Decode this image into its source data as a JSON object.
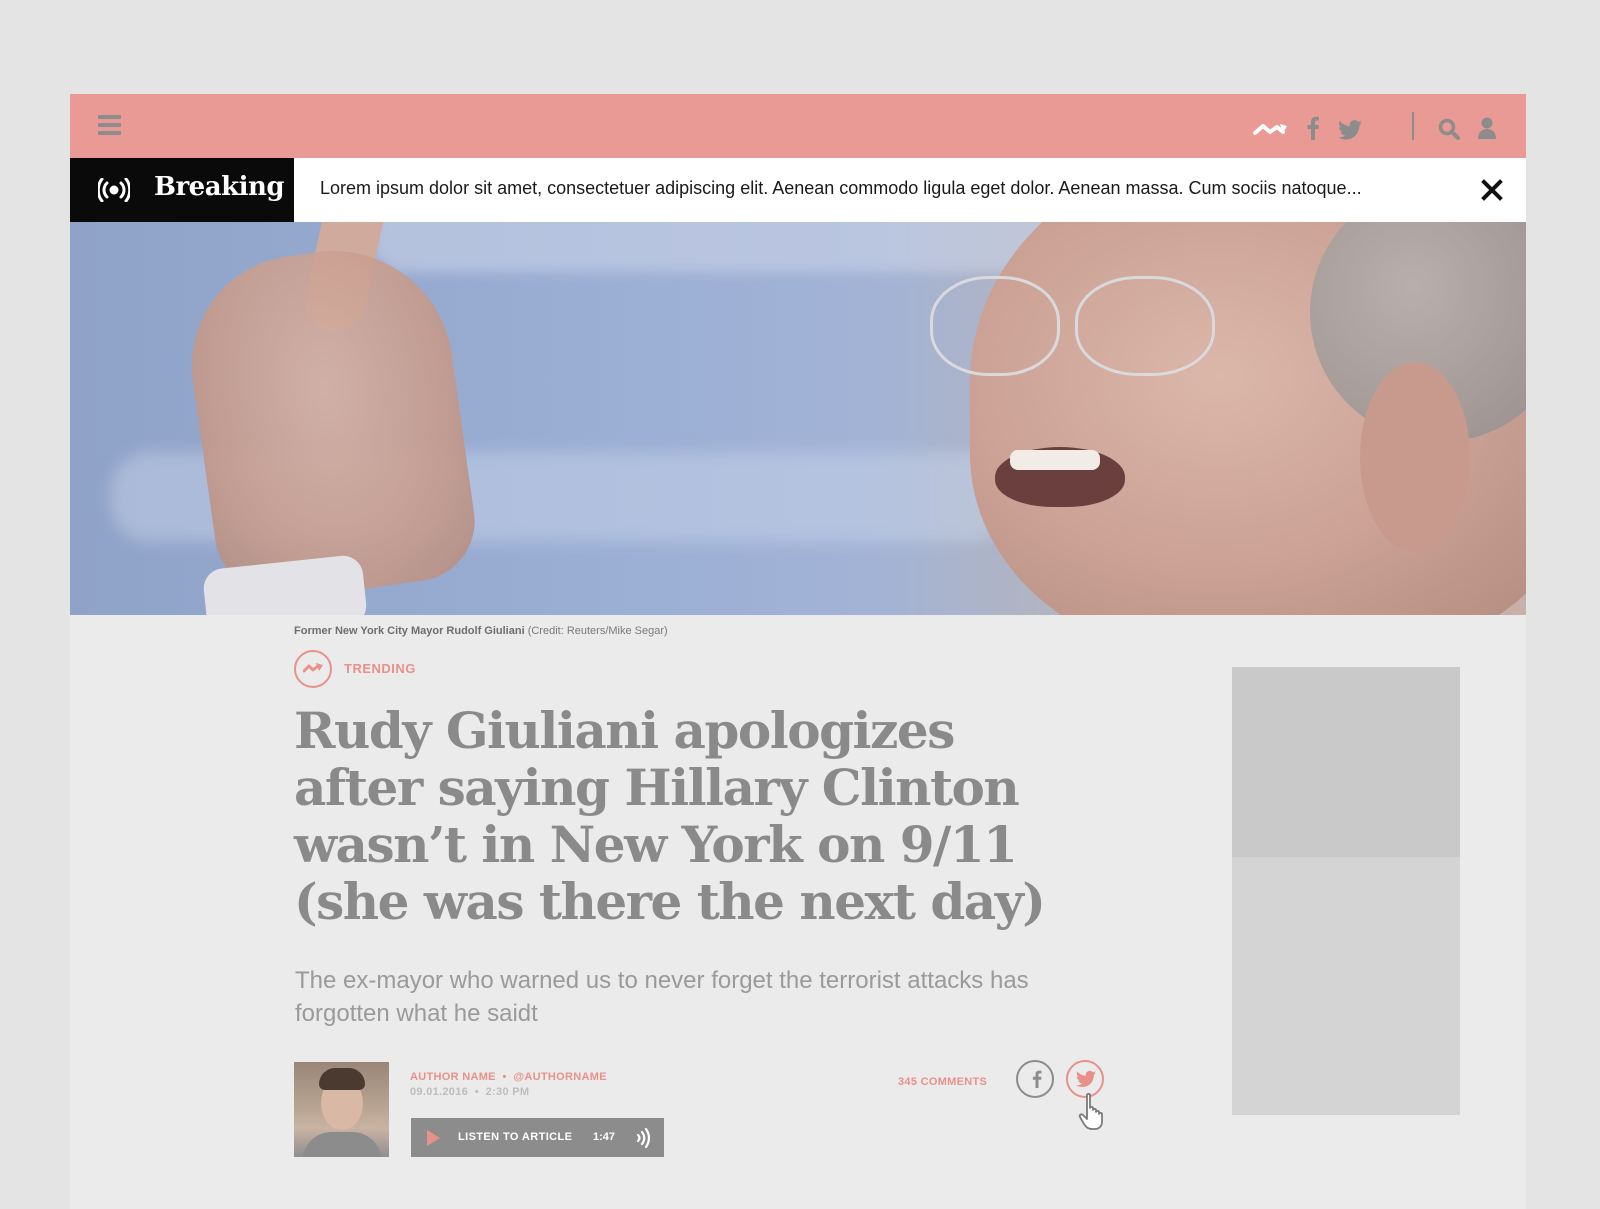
{
  "topbar": {
    "icons": [
      "menu-icon",
      "trending-icon",
      "facebook-icon",
      "twitter-icon",
      "search-icon",
      "user-icon"
    ]
  },
  "breaking": {
    "label": "Breaking",
    "icon": "broadcast-icon",
    "text": "Lorem ipsum dolor sit amet, consectetuer adipiscing elit. Aenean commodo ligula eget dolor. Aenean massa. Cum sociis natoque...",
    "close_icon": "close-icon"
  },
  "hero": {
    "caption_subject": "Former New York City Mayor Rudolf Giuliani",
    "caption_credit": "(Credit: Reuters/Mike Segar)"
  },
  "article": {
    "section": "TRENDING",
    "headline": "Rudy Giuliani apologizes after saying Hillary Clinton wasn’t in New York on 9/11 (she was there the next day)",
    "dek": "The ex-mayor who warned us to never forget the terrorist attacks has forgotten what he saidt"
  },
  "byline": {
    "author_name": "AUTHOR NAME",
    "author_handle": "@AUTHORNAME",
    "separator": "•",
    "date": "09.01.2016",
    "time": "2:30 PM"
  },
  "audio": {
    "label": "LISTEN TO ARTICLE",
    "duration": "1:47"
  },
  "social": {
    "comments": "345 COMMENTS"
  },
  "colors": {
    "accent": "#ea9a94",
    "breaking_bg": "#0a0a0a",
    "headline": "#8a8a8a",
    "page_bg": "#ebebeb"
  }
}
